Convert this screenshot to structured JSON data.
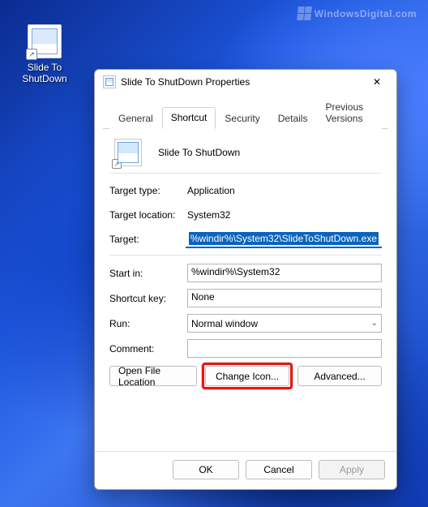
{
  "watermark": "WindowsDigital.com",
  "desktop_icon": {
    "label": "Slide To\nShutDown"
  },
  "window": {
    "title": "Slide To ShutDown Properties",
    "tabs": [
      "General",
      "Shortcut",
      "Security",
      "Details",
      "Previous Versions"
    ],
    "active_tab_index": 1,
    "shortcut": {
      "name": "Slide To ShutDown",
      "target_type_label": "Target type:",
      "target_type_value": "Application",
      "target_location_label": "Target location:",
      "target_location_value": "System32",
      "target_label": "Target:",
      "target_value": "%windir%\\System32\\SlideToShutDown.exe",
      "startin_label": "Start in:",
      "startin_value": "%windir%\\System32",
      "shortcutkey_label": "Shortcut key:",
      "shortcutkey_value": "None",
      "run_label": "Run:",
      "run_value": "Normal window",
      "comment_label": "Comment:",
      "comment_value": "",
      "open_file_location": "Open File Location",
      "change_icon": "Change Icon...",
      "advanced": "Advanced..."
    },
    "footer": {
      "ok": "OK",
      "cancel": "Cancel",
      "apply": "Apply"
    }
  }
}
